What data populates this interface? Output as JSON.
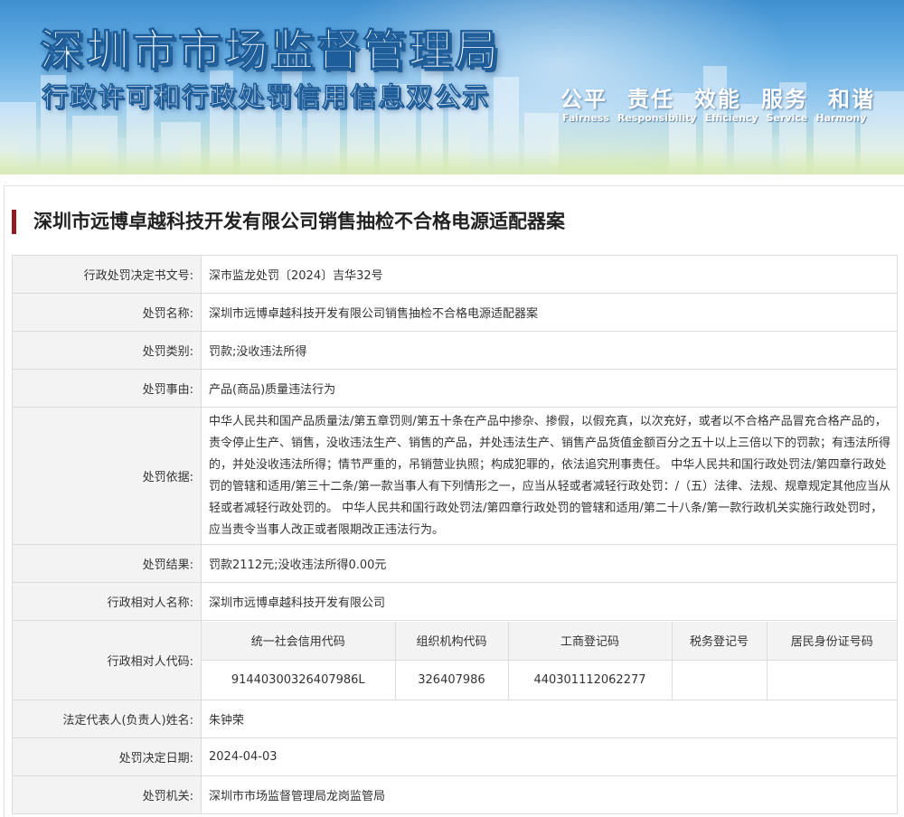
{
  "banner": {
    "title": "深圳市市场监督管理局",
    "subtitle": "行政许可和行政处罚信用信息双公示",
    "values": [
      {
        "cn": "公平",
        "en": "Fairness"
      },
      {
        "cn": "责任",
        "en": "Responsibility"
      },
      {
        "cn": "效能",
        "en": "Efficiency"
      },
      {
        "cn": "服务",
        "en": "Service"
      },
      {
        "cn": "和谐",
        "en": "Harmony"
      }
    ]
  },
  "case": {
    "title": "深圳市远博卓越科技开发有限公司销售抽检不合格电源适配器案",
    "fields": {
      "decision_no": {
        "label": "行政处罚决定书文号:",
        "value": "深市监龙处罚〔2024〕吉华32号"
      },
      "penalty_name": {
        "label": "处罚名称:",
        "value": "深圳市远博卓越科技开发有限公司销售抽检不合格电源适配器案"
      },
      "penalty_type": {
        "label": "处罚类别:",
        "value": "罚款;没收违法所得"
      },
      "penalty_reason": {
        "label": "处罚事由:",
        "value": "产品(商品)质量违法行为"
      },
      "penalty_basis": {
        "label": "处罚依据:",
        "value": "中华人民共和国产品质量法/第五章罚则/第五十条在产品中掺杂、掺假，以假充真，以次充好，或者以不合格产品冒充合格产品的，责令停止生产、销售，没收违法生产、销售的产品，并处违法生产、销售产品货值金额百分之五十以上三倍以下的罚款；有违法所得的，并处没收违法所得；情节严重的，吊销营业执照；构成犯罪的，依法追究刑事责任。 中华人民共和国行政处罚法/第四章行政处罚的管辖和适用/第三十二条/第一款当事人有下列情形之一，应当从轻或者减轻行政处罚：/（五）法律、法规、规章规定其他应当从轻或者减轻行政处罚的。 中华人民共和国行政处罚法/第四章行政处罚的管辖和适用/第二十八条/第一款行政机关实施行政处罚时，应当责令当事人改正或者限期改正违法行为。"
      },
      "penalty_result": {
        "label": "处罚结果:",
        "value": "罚款2112元;没收违法所得0.00元"
      },
      "party_name": {
        "label": "行政相对人名称:",
        "value": "深圳市远博卓越科技开发有限公司"
      },
      "party_code": {
        "label": "行政相对人代码:",
        "headers": [
          "统一社会信用代码",
          "组织机构代码",
          "工商登记码",
          "税务登记号",
          "居民身份证号码"
        ],
        "values": [
          "91440300326407986L",
          "326407986",
          "440301112062277",
          "",
          ""
        ]
      },
      "legal_rep": {
        "label": "法定代表人(负责人)姓名:",
        "value": "朱钟荣"
      },
      "decision_date": {
        "label": "处罚决定日期:",
        "value": "2024-04-03"
      },
      "authority": {
        "label": "处罚机关:",
        "value": "深圳市市场监督管理局龙岗监管局"
      }
    }
  }
}
